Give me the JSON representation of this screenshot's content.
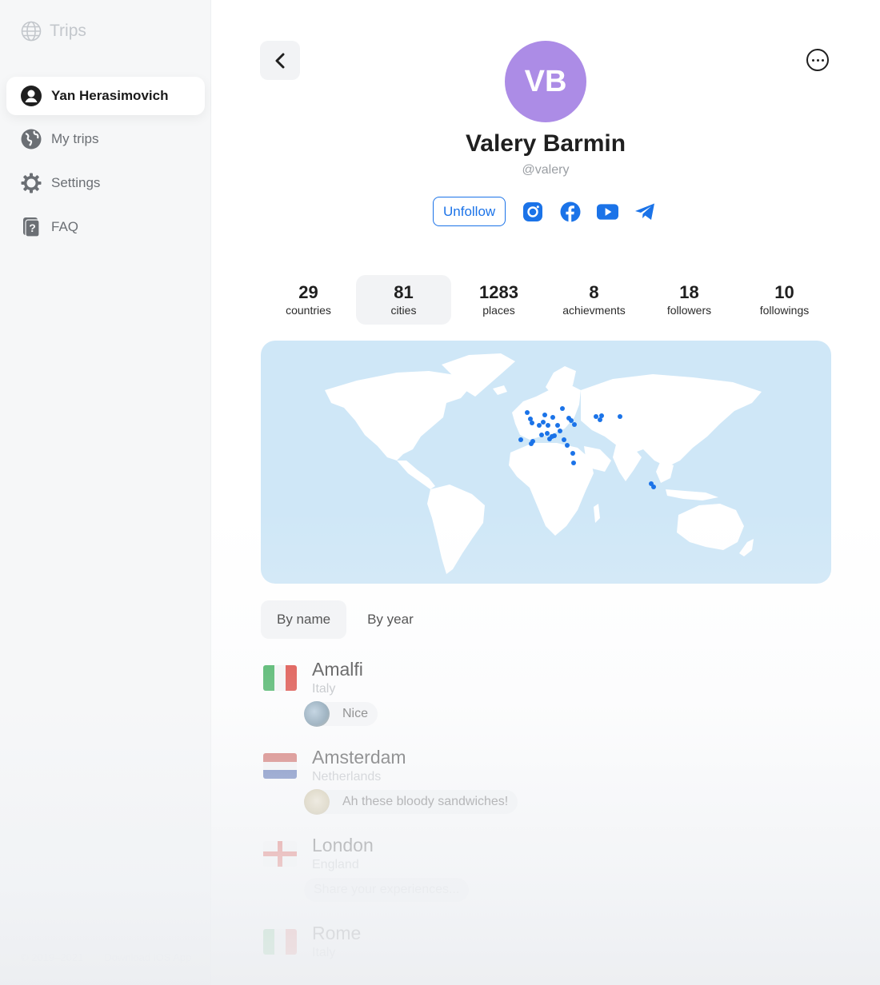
{
  "sidebar": {
    "brand": "Trips",
    "items": [
      {
        "label": "Yan Herasimovich",
        "icon": "user-icon"
      },
      {
        "label": "My trips",
        "icon": "globe-icon"
      },
      {
        "label": "Settings",
        "icon": "gear-icon"
      },
      {
        "label": "FAQ",
        "icon": "question-icon"
      }
    ],
    "footer": {
      "copyright": "© 2019–2021",
      "download": "Download iOS App"
    }
  },
  "profile": {
    "initials": "VB",
    "avatar_color": "#ac8ce6",
    "name": "Valery Barmin",
    "handle": "@valery",
    "unfollow_label": "Unfollow",
    "socials": [
      "instagram-icon",
      "facebook-icon",
      "youtube-icon",
      "telegram-icon"
    ],
    "accent_color": "#1b73e8"
  },
  "stats": [
    {
      "value": "29",
      "label": "countries"
    },
    {
      "value": "81",
      "label": "cities"
    },
    {
      "value": "1283",
      "label": "places"
    },
    {
      "value": "8",
      "label": "achievments"
    },
    {
      "value": "18",
      "label": "followers"
    },
    {
      "value": "10",
      "label": "followings"
    }
  ],
  "tabs": [
    "By name",
    "By year"
  ],
  "cities": [
    {
      "name": "Amalfi",
      "country": "Italy",
      "note": "Nice",
      "flag": "italy"
    },
    {
      "name": "Amsterdam",
      "country": "Netherlands",
      "note": "Ah these bloody sandwiches!",
      "flag": "netherlands"
    },
    {
      "name": "London",
      "country": "England",
      "note": "Share your experiences...",
      "flag": "england"
    },
    {
      "name": "Rome",
      "country": "Italy",
      "flag": "italy"
    }
  ]
}
